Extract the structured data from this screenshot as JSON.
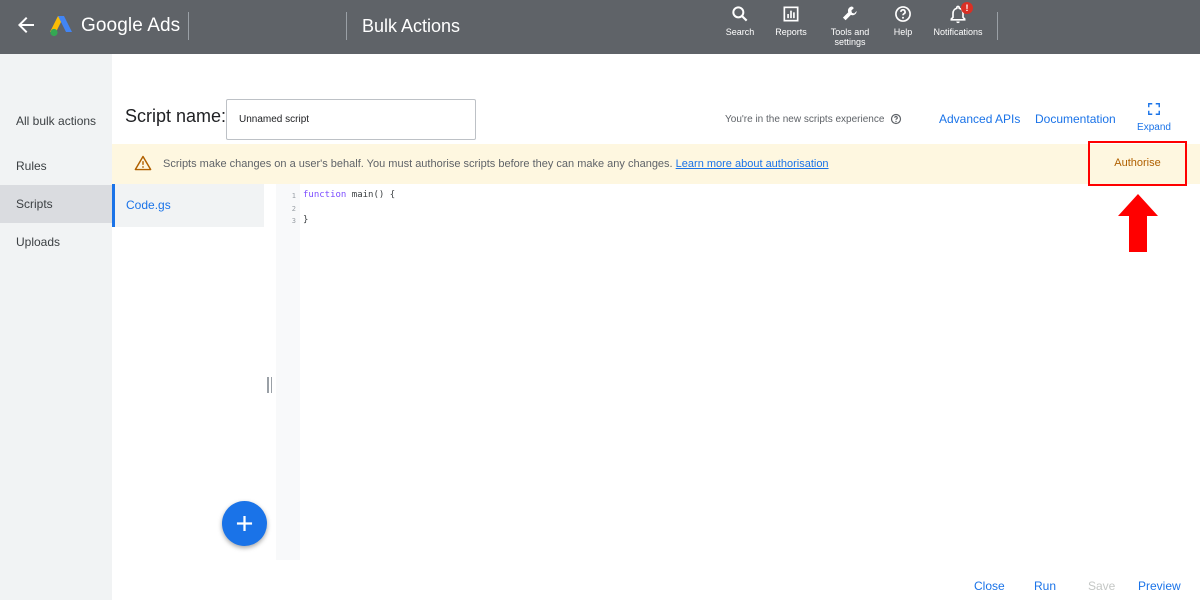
{
  "header": {
    "brand": "Google Ads",
    "page_title": "Bulk Actions",
    "actions": [
      {
        "label": "Search",
        "icon": "search-icon"
      },
      {
        "label": "Reports",
        "icon": "reports-icon"
      },
      {
        "label": "Tools and settings",
        "icon": "wrench-icon"
      },
      {
        "label": "Help",
        "icon": "help-icon"
      },
      {
        "label": "Notifications",
        "icon": "bell-icon",
        "badge": "!"
      }
    ],
    "bar_color": "#5f6368"
  },
  "sidebar": {
    "items": [
      {
        "label": "All bulk actions",
        "active": false
      },
      {
        "label": "Rules",
        "active": false
      },
      {
        "label": "Scripts",
        "active": true
      },
      {
        "label": "Uploads",
        "active": false
      }
    ]
  },
  "script": {
    "name_label": "Script name:",
    "name_value": "Unnamed script",
    "experience_text": "You're in the new scripts experience",
    "advanced_apis": "Advanced APIs",
    "documentation": "Documentation",
    "expand": "Expand"
  },
  "banner": {
    "text": "Scripts make changes on a user's behalf. You must authorise scripts before they can make any changes.",
    "link": "Learn more about authorisation",
    "button": "Authorise",
    "background": "#fef7e0"
  },
  "files": [
    {
      "name": "Code.gs",
      "active": true
    }
  ],
  "editor": {
    "lines": [
      {
        "num": "1",
        "code_kw": "function",
        "code_rest": " main() {"
      },
      {
        "num": "2",
        "code_kw": "",
        "code_rest": ""
      },
      {
        "num": "3",
        "code_kw": "",
        "code_rest": "}"
      }
    ]
  },
  "footer": {
    "close": "Close",
    "run": "Run",
    "save": "Save",
    "preview": "Preview"
  },
  "colors": {
    "accent": "#1a73e8",
    "highlight": "#ff0000"
  }
}
